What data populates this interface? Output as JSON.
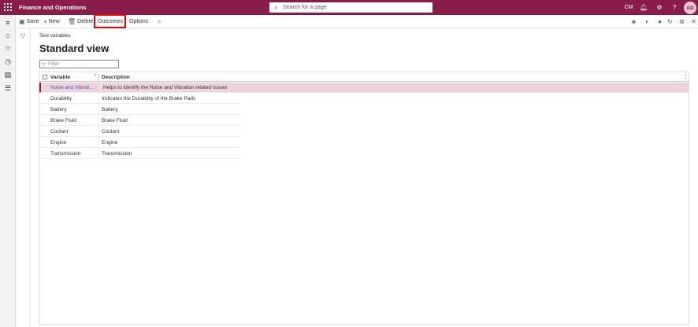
{
  "topbar": {
    "app_title": "Finance and Operations",
    "search_placeholder": "Search for a page",
    "company": "CM",
    "avatar_initials": "AD"
  },
  "actionbar": {
    "save": "Save",
    "new": "New",
    "delete": "Delete",
    "outcomes": "Outcomes",
    "options": "Options"
  },
  "page": {
    "breadcrumb": "Test variables",
    "view_title": "Standard view",
    "filter_placeholder": "Filter"
  },
  "grid": {
    "columns": [
      "Variable",
      "Description"
    ],
    "rows": [
      {
        "variable": "Noise and Vibrati...",
        "description": "Helps to identify the Noise and Vibration related issues"
      },
      {
        "variable": "Durability",
        "description": "Indicates the Durability of the Brake Pads"
      },
      {
        "variable": "Battery",
        "description": "Battery"
      },
      {
        "variable": "Brake Fluid",
        "description": "Brake Fluid"
      },
      {
        "variable": "Coolant",
        "description": "Coolant"
      },
      {
        "variable": "Engine",
        "description": "Engine"
      },
      {
        "variable": "Transmission",
        "description": "Transmission"
      }
    ]
  },
  "colors": {
    "brand": "#8a1c4a",
    "selected_row": "#ecd3dc",
    "highlight": "#ee0000"
  }
}
